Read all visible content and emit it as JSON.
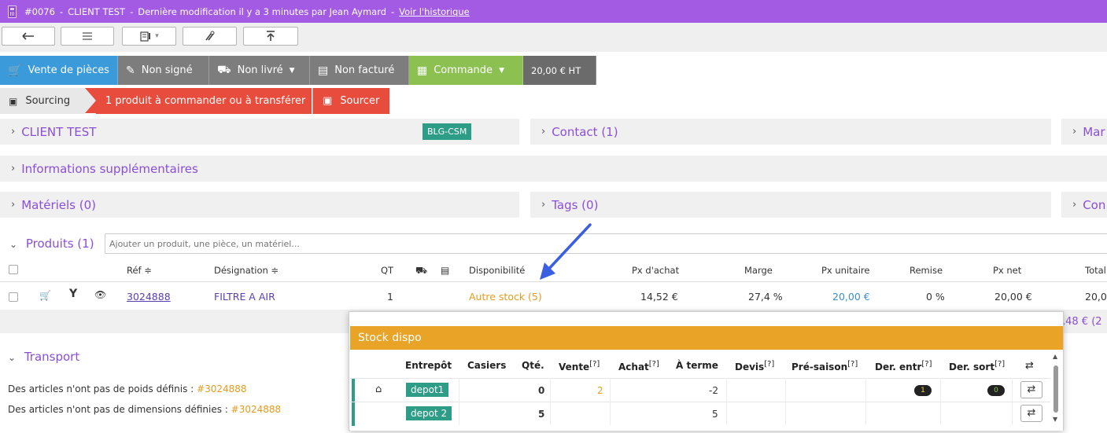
{
  "topbar": {
    "doc_number": "#0076",
    "client": "CLIENT TEST",
    "modified": "Dernière modification il y a 3 minutes par Jean Aymard",
    "history_link": "Voir l'historique",
    "separator": "-"
  },
  "toolbar": {
    "back_icon": "arrow-left-icon",
    "list_icon": "list-icon",
    "print_icon": "print-invoice-icon",
    "tools_icon": "tools-icon",
    "upload_icon": "upload-icon",
    "caret": "▾"
  },
  "status": {
    "type_label": "Vente de pièces",
    "signed_label": "Non signé",
    "delivered_label": "Non livré",
    "invoiced_label": "Non facturé",
    "order_label": "Commande",
    "amount_label": "20,00 € HT",
    "caret": "▼",
    "colors": {
      "purple": "#a35be3",
      "blue": "#3b9ad9",
      "gray": "#7d7d7d",
      "green": "#8cc152",
      "dark": "#6b6b6b"
    }
  },
  "sourcing": {
    "label": "Sourcing",
    "message": "1 produit à commander ou à transférer",
    "button": "Sourcer",
    "color": "#e74c3c"
  },
  "panels": {
    "client": "CLIENT TEST",
    "client_badge": "BLG-CSM",
    "contact": "Contact (1)",
    "right1": "Mar",
    "info": "Informations supplémentaires",
    "materials": "Matériels (0)",
    "tags": "Tags (0)",
    "right2": "Con",
    "chevron": "›"
  },
  "products": {
    "title": "Produits (1)",
    "placeholder": "Ajouter un produit, une pièce, un matériel...",
    "chevron": "⌄",
    "columns": {
      "ref": "Réf ≑",
      "designation": "Désignation ≑",
      "qt": "QT",
      "availability": "Disponibilité",
      "purchase": "Px d'achat",
      "margin": "Marge",
      "unit": "Px unitaire",
      "discount": "Remise",
      "net": "Px net",
      "total": "Total"
    },
    "row": {
      "ref": "3024888",
      "designation": "FILTRE A AIR",
      "qt": "1",
      "availability": "Autre stock (5)",
      "purchase": "14,52 €",
      "margin": "27,4 %",
      "unit": "20,00 €",
      "discount": "0 %",
      "net": "20,00 €",
      "total": "20,0"
    },
    "total_partial": ",48 € (2"
  },
  "transport": {
    "title": "Transport",
    "chevron": "⌄",
    "line1": "Des articles n'ont pas de poids définis : ",
    "line1_ref": "#3024888",
    "line2": "Des articles n'ont pas de dimensions définies : ",
    "line2_ref": "#3024888"
  },
  "stock": {
    "title": "Stock dispo",
    "headers": {
      "warehouse": "Entrepôt",
      "bins": "Casiers",
      "qty": "Qté.",
      "sale": "Vente",
      "purchase": "Achat",
      "term": "À terme",
      "quote": "Devis",
      "preseason": "Pré-saison",
      "last_in": "Der. entr",
      "last_out": "Der. sort",
      "hint": "[?]",
      "swap_icon": "⇄"
    },
    "rows": [
      {
        "warehouse": "depot1",
        "qty": "0",
        "sale": "2",
        "term": "-2",
        "last_in": "1",
        "last_out": "0"
      },
      {
        "warehouse": "depot 2",
        "qty": "5",
        "sale": "",
        "term": "5",
        "last_in": "",
        "last_out": ""
      }
    ],
    "color": "#e9a326",
    "depot_color": "#2e9d87"
  }
}
